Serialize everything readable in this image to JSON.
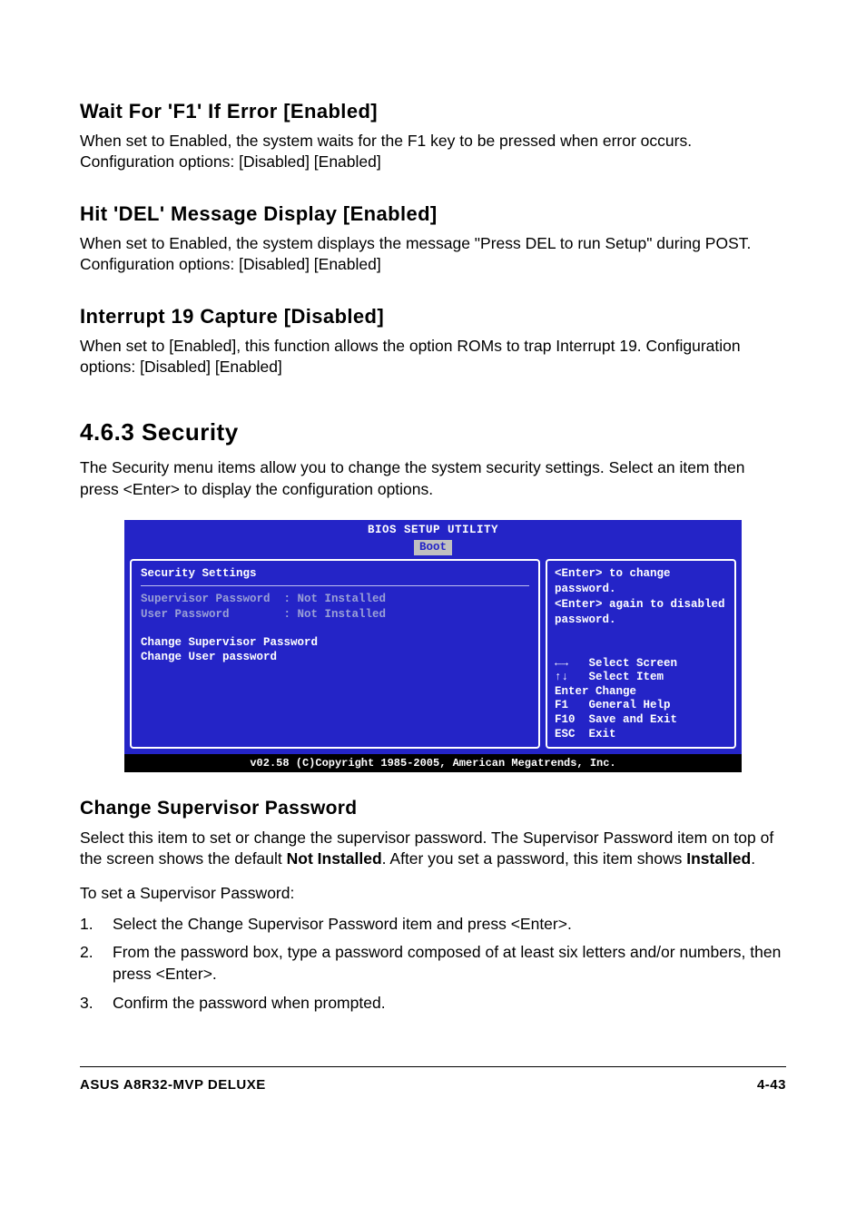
{
  "s1": {
    "title": "Wait For 'F1' If Error [Enabled]",
    "body": "When set to Enabled, the system waits for the F1 key to be pressed when error occurs. Configuration options: [Disabled] [Enabled]"
  },
  "s2": {
    "title": "Hit 'DEL' Message Display [Enabled]",
    "body": "When set to Enabled, the system displays the message \"Press DEL to run Setup\" during POST. Configuration options: [Disabled] [Enabled]"
  },
  "s3": {
    "title": "Interrupt 19 Capture [Disabled]",
    "body": "When set to [Enabled], this function allows the option ROMs to trap Interrupt 19. Configuration options: [Disabled] [Enabled]"
  },
  "section": {
    "num_title": "4.6.3   Security",
    "intro": "The Security menu items allow you to change the system security settings. Select an item then press <Enter> to display the configuration options."
  },
  "bios": {
    "util": "BIOS SETUP UTILITY",
    "tab": "Boot",
    "sec_head": "Security Settings",
    "line1": "Supervisor Password  : Not Installed",
    "line2": "User Password        : Not Installed",
    "line3": "Change Supervisor Password",
    "line4": "Change User password",
    "help": "<Enter> to change password.\n<Enter> again to disabled password.",
    "nav": "←→   Select Screen\n↑↓   Select Item\nEnter Change\nF1   General Help\nF10  Save and Exit\nESC  Exit",
    "footer": "v02.58 (C)Copyright 1985-2005, American Megatrends, Inc."
  },
  "csp": {
    "title": "Change Supervisor Password",
    "p1a": "Select this item to set or change the supervisor password. The Supervisor Password item on top of the screen shows the default ",
    "p1b": "Not Installed",
    "p1c": ". After you set a password, this item shows ",
    "p1d": "Installed",
    "p1e": ".",
    "intro": "To set a Supervisor Password:",
    "steps": [
      "Select the Change Supervisor Password item and press <Enter>.",
      "From the password box, type a password composed of at least six letters and/or numbers, then press <Enter>.",
      "Confirm the password when prompted."
    ]
  },
  "footer": {
    "left": "ASUS A8R32-MVP DELUXE",
    "right": "4-43"
  }
}
